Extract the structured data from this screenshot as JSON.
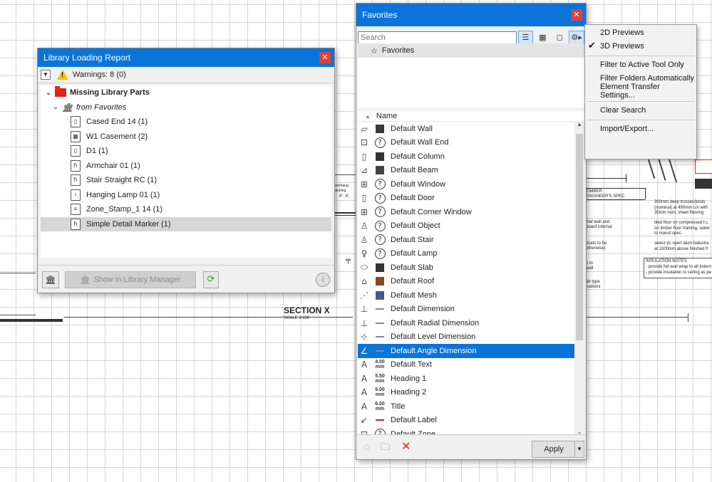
{
  "drawing": {
    "section_title": "SECTION X",
    "section_scale": "SCALE 1:100",
    "note_timber": "TIMBER",
    "note_engineer": "ENGINEER'S SPEC.",
    "note_insulation": "INSULATION NOTES",
    "note_1": "300mm deep trusses/joists",
    "note_2": "(nominal) at 450mm c/s with",
    "note_3": "30mm nom. sheet flooring",
    "note_4": "tiled floor on compressed f.c.",
    "note_5": "on timber floor framing, water",
    "note_6": "to manuf.spec.",
    "note_7": "select pc open alum balustra",
    "note_8": "at 1000mm above finished fl",
    "note_9": "- provide foil wall wrap to all extern",
    "note_10": "- provide insulation to ceiling as pe",
    "note_11": "overhang",
    "note_12": "pitching",
    "note_13": "mal wall and",
    "note_14": "board internal",
    "note_15": "studs to be",
    "note_16": "otherwise)",
    "note_17": "n to",
    "note_18": "wall",
    "note_19": "ab type",
    "note_20": "ications"
  },
  "llr": {
    "title": "Library Loading Report",
    "warnings": "Warnings: 8 (0)",
    "tree": {
      "root": "Missing Library Parts",
      "group": "from Favorites",
      "items": [
        {
          "label": "Cased End 14 (1)",
          "icon": "door-icon"
        },
        {
          "label": "W1 Casement (2)",
          "icon": "window-icon"
        },
        {
          "label": "D1 (1)",
          "icon": "door-icon"
        },
        {
          "label": "Armchair 01 (1)",
          "icon": "chair-icon"
        },
        {
          "label": "Stair Straight RC (1)",
          "icon": "stair-icon"
        },
        {
          "label": "Hanging Lamp 01 (1)",
          "icon": "lamp-icon"
        },
        {
          "label": "Zone_Stamp_1 14 (1)",
          "icon": "zone-icon"
        },
        {
          "label": "Simple Detail Marker (1)",
          "icon": "marker-icon"
        }
      ]
    },
    "show_btn": "Show in Library Manager"
  },
  "fav": {
    "title": "Favorites",
    "search_placeholder": "Search",
    "folder_label": "Favorites",
    "name_header": "Name",
    "items": [
      {
        "label": "Default Wall",
        "q": false
      },
      {
        "label": "Default Wall End",
        "q": true
      },
      {
        "label": "Default Column",
        "q": false
      },
      {
        "label": "Default Beam",
        "q": false
      },
      {
        "label": "Default Window",
        "q": true
      },
      {
        "label": "Default Door",
        "q": true
      },
      {
        "label": "Default Corner Window",
        "q": true
      },
      {
        "label": "Default Object",
        "q": true
      },
      {
        "label": "Default Stair",
        "q": true
      },
      {
        "label": "Default Lamp",
        "q": true
      },
      {
        "label": "Default Slab",
        "q": false
      },
      {
        "label": "Default Roof",
        "q": false
      },
      {
        "label": "Default Mesh",
        "q": false
      },
      {
        "label": "Default Dimension",
        "q": false
      },
      {
        "label": "Default Radial Dimension",
        "q": false
      },
      {
        "label": "Default Level Dimension",
        "q": false
      },
      {
        "label": "Default Angle Dimension",
        "q": false
      },
      {
        "label": "Default Text",
        "q": false,
        "t": "4.00 mm"
      },
      {
        "label": "Heading 1",
        "q": false,
        "t": "5.50 mm"
      },
      {
        "label": "Heading 2",
        "q": false,
        "t": "5.00 mm"
      },
      {
        "label": "Title",
        "q": false,
        "t": "6.00 mm"
      },
      {
        "label": "Default Label",
        "q": false
      },
      {
        "label": "Default Zone",
        "q": true
      }
    ],
    "apply": "Apply"
  },
  "menu": {
    "items": [
      "2D Previews",
      "3D Previews",
      "Filter to Active Tool Only",
      "Filter Folders Automatically",
      "Element Transfer Settings...",
      "Clear Search",
      "Import/Export..."
    ]
  }
}
